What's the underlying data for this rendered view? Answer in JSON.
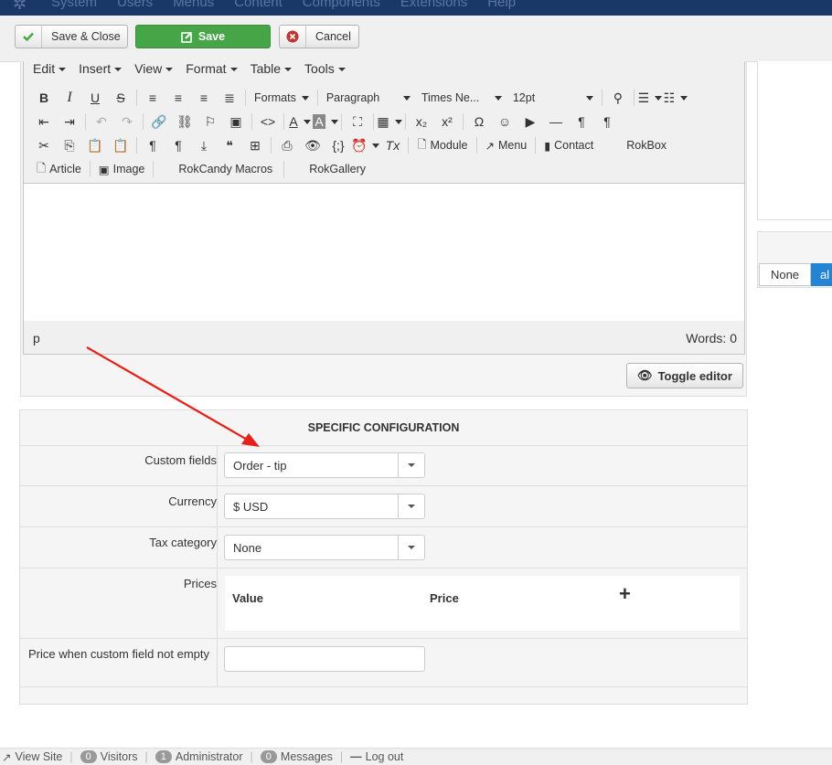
{
  "topnav": {
    "items": [
      "System",
      "Users",
      "Menus",
      "Content",
      "Components",
      "Extensions",
      "Help"
    ]
  },
  "toolbar": {
    "save_close": "Save & Close",
    "save": "Save",
    "cancel": "Cancel"
  },
  "editor": {
    "menus": [
      "Edit",
      "Insert",
      "View",
      "Format",
      "Table",
      "Tools"
    ],
    "formats_label": "Formats",
    "block_label": "Paragraph",
    "font_label": "Times Ne...",
    "size_label": "12pt",
    "module_label": "Module",
    "menu_label": "Menu",
    "contact_label": "Contact",
    "rokbox_label": "RokBox",
    "article_label": "Article",
    "image_label": "Image",
    "rokcandy_label": "RokCandy Macros",
    "rokgallery_label": "RokGallery",
    "path": "p",
    "words": "Words: 0",
    "toggle_label": "Toggle editor"
  },
  "side": {
    "none_label": "None",
    "all_label": "al"
  },
  "config": {
    "title": "SPECIFIC CONFIGURATION",
    "custom_fields_label": "Custom fields",
    "custom_fields_value": "Order - tip",
    "currency_label": "Currency",
    "currency_value": "$ USD",
    "tax_label": "Tax category",
    "tax_value": "None",
    "prices_label": "Prices",
    "prices_col_value": "Value",
    "prices_col_price": "Price",
    "price_empty_label": "Price when custom field not empty",
    "price_empty_value": ""
  },
  "footer": {
    "view_site": "View Site",
    "visitors_count": "0",
    "visitors_label": "Visitors",
    "admin_count": "1",
    "admin_label": "Administrator",
    "messages_count": "0",
    "messages_label": "Messages",
    "logout": "Log out"
  },
  "colors": {
    "accent_green": "#46a546",
    "accent_blue": "#2384d3",
    "topbar": "#1a3867",
    "arrow": "#e8201a"
  }
}
